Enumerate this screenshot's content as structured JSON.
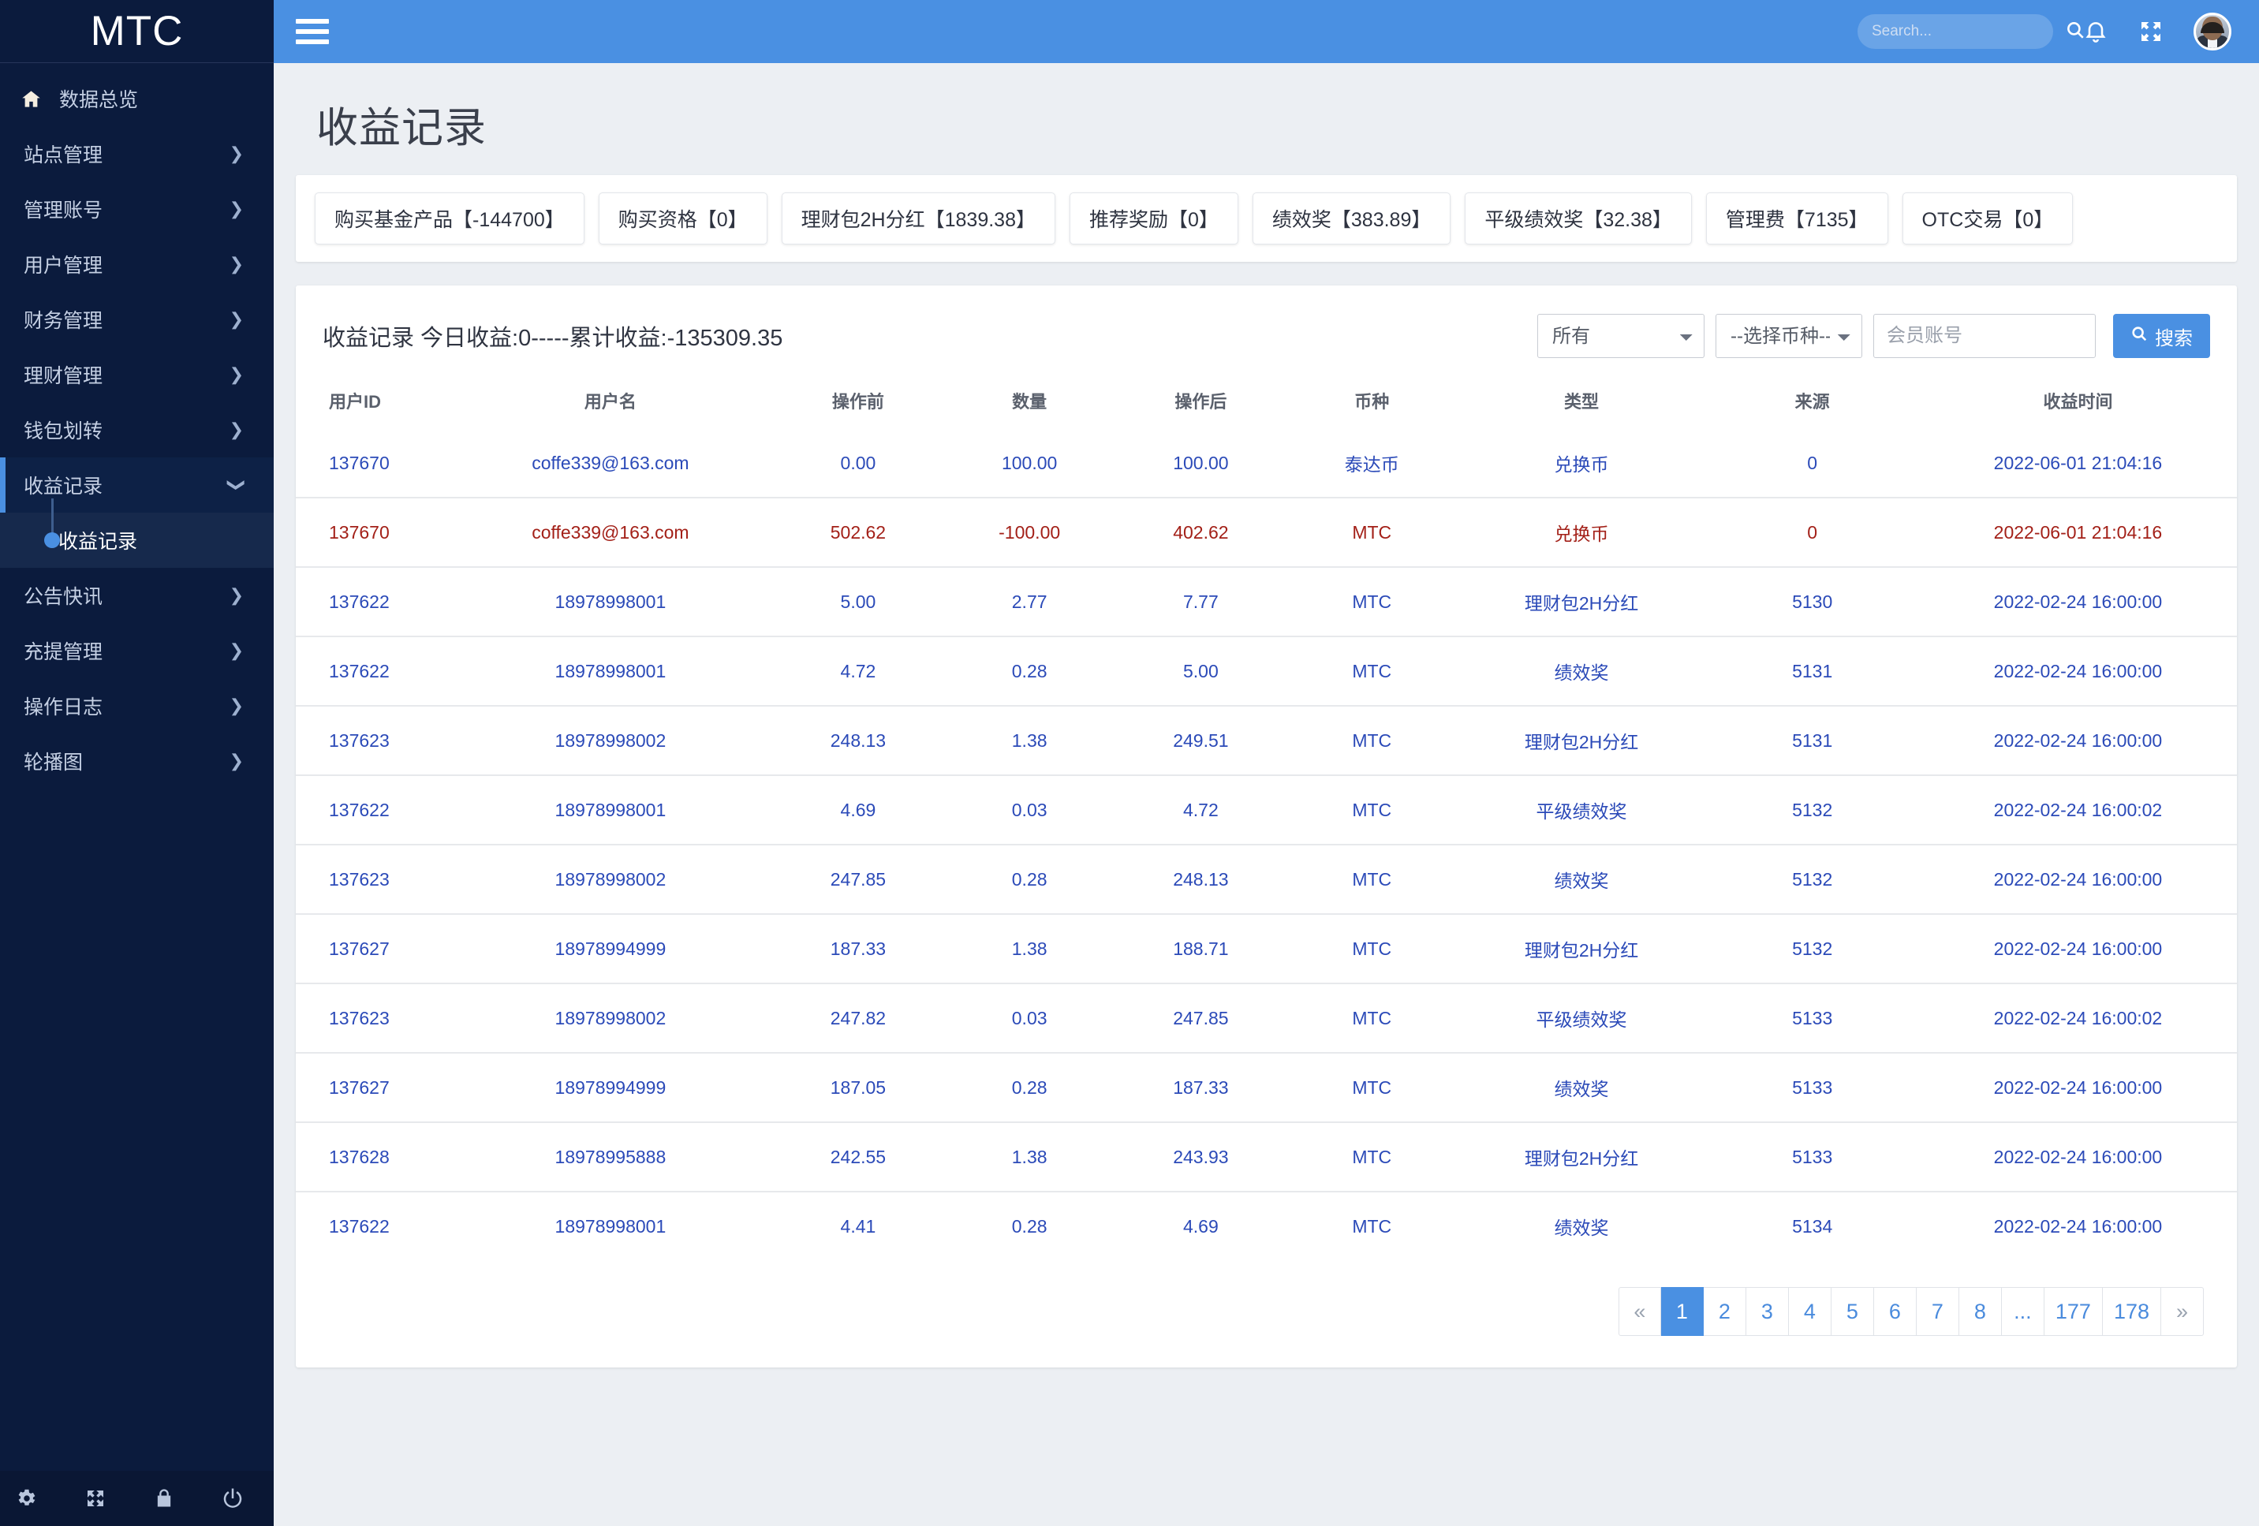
{
  "brand": {
    "title": "MTC"
  },
  "topbar": {
    "menu_icon": "hamburger-icon",
    "search_placeholder": "Search...",
    "search_value": "",
    "bell_icon": "bell-icon",
    "fullscreen_icon": "expand-icon",
    "avatar": "user-avatar"
  },
  "sidebar": {
    "home": {
      "label": "数据总览",
      "icon": "home-icon"
    },
    "items": [
      {
        "label": "站点管理",
        "expandable": true
      },
      {
        "label": "管理账号",
        "expandable": true
      },
      {
        "label": "用户管理",
        "expandable": true
      },
      {
        "label": "财务管理",
        "expandable": true
      },
      {
        "label": "理财管理",
        "expandable": true
      },
      {
        "label": "钱包划转",
        "expandable": true
      }
    ],
    "active_group": {
      "label": "收益记录",
      "expandable": true
    },
    "active_sub": {
      "label": "收益记录"
    },
    "items_after": [
      {
        "label": "公告快讯",
        "expandable": true
      },
      {
        "label": "充提管理",
        "expandable": true
      },
      {
        "label": "操作日志",
        "expandable": true
      },
      {
        "label": "轮播图",
        "expandable": true
      }
    ],
    "footer_icons": [
      "gear-icon",
      "expand-icon",
      "lock-icon",
      "power-icon"
    ]
  },
  "page": {
    "title": "收益记录"
  },
  "stats": [
    {
      "label": "购买基金产品【-144700】"
    },
    {
      "label": "购买资格【0】"
    },
    {
      "label": "理财包2H分红【1839.38】"
    },
    {
      "label": "推荐奖励【0】"
    },
    {
      "label": "绩效奖【383.89】"
    },
    {
      "label": "平级绩效奖【32.38】"
    },
    {
      "label": "管理费【7135】"
    },
    {
      "label": "OTC交易【0】"
    }
  ],
  "table": {
    "caption": "收益记录 今日收益:0-----累计收益:-135309.35",
    "filters": {
      "type_select": {
        "value": "所有",
        "options": [
          "所有"
        ]
      },
      "coin_select": {
        "value": "--选择币种--",
        "options": [
          "--选择币种--"
        ]
      },
      "account_input": {
        "value": "",
        "placeholder": "会员账号"
      },
      "search_button": "搜索"
    },
    "columns": [
      "用户ID",
      "用户名",
      "操作前",
      "数量",
      "操作后",
      "币种",
      "类型",
      "来源",
      "收益时间"
    ],
    "rows": [
      {
        "color": "blue",
        "cells": [
          "137670",
          "coffe339@163.com",
          "0.00",
          "100.00",
          "100.00",
          "泰达币",
          "兑换币",
          "0",
          "2022-06-01 21:04:16"
        ]
      },
      {
        "color": "red",
        "cells": [
          "137670",
          "coffe339@163.com",
          "502.62",
          "-100.00",
          "402.62",
          "MTC",
          "兑换币",
          "0",
          "2022-06-01 21:04:16"
        ]
      },
      {
        "color": "blue",
        "cells": [
          "137622",
          "18978998001",
          "5.00",
          "2.77",
          "7.77",
          "MTC",
          "理财包2H分红",
          "5130",
          "2022-02-24 16:00:00"
        ]
      },
      {
        "color": "blue",
        "cells": [
          "137622",
          "18978998001",
          "4.72",
          "0.28",
          "5.00",
          "MTC",
          "绩效奖",
          "5131",
          "2022-02-24 16:00:00"
        ]
      },
      {
        "color": "blue",
        "cells": [
          "137623",
          "18978998002",
          "248.13",
          "1.38",
          "249.51",
          "MTC",
          "理财包2H分红",
          "5131",
          "2022-02-24 16:00:00"
        ]
      },
      {
        "color": "blue",
        "cells": [
          "137622",
          "18978998001",
          "4.69",
          "0.03",
          "4.72",
          "MTC",
          "平级绩效奖",
          "5132",
          "2022-02-24 16:00:02"
        ]
      },
      {
        "color": "blue",
        "cells": [
          "137623",
          "18978998002",
          "247.85",
          "0.28",
          "248.13",
          "MTC",
          "绩效奖",
          "5132",
          "2022-02-24 16:00:00"
        ]
      },
      {
        "color": "blue",
        "cells": [
          "137627",
          "18978994999",
          "187.33",
          "1.38",
          "188.71",
          "MTC",
          "理财包2H分红",
          "5132",
          "2022-02-24 16:00:00"
        ]
      },
      {
        "color": "blue",
        "cells": [
          "137623",
          "18978998002",
          "247.82",
          "0.03",
          "247.85",
          "MTC",
          "平级绩效奖",
          "5133",
          "2022-02-24 16:00:02"
        ]
      },
      {
        "color": "blue",
        "cells": [
          "137627",
          "18978994999",
          "187.05",
          "0.28",
          "187.33",
          "MTC",
          "绩效奖",
          "5133",
          "2022-02-24 16:00:00"
        ]
      },
      {
        "color": "blue",
        "cells": [
          "137628",
          "18978995888",
          "242.55",
          "1.38",
          "243.93",
          "MTC",
          "理财包2H分红",
          "5133",
          "2022-02-24 16:00:00"
        ]
      },
      {
        "color": "blue",
        "cells": [
          "137622",
          "18978998001",
          "4.41",
          "0.28",
          "4.69",
          "MTC",
          "绩效奖",
          "5134",
          "2022-02-24 16:00:00"
        ]
      }
    ],
    "pagination": {
      "prev": "«",
      "next": "»",
      "pages": [
        "1",
        "2",
        "3",
        "4",
        "5",
        "6",
        "7",
        "8",
        "...",
        "177",
        "178"
      ],
      "active": "1"
    }
  },
  "colors": {
    "sidebar_bg": "#0b1b3d",
    "topbar_blue": "#4a90e2",
    "row_blue": "#2b4ab8",
    "row_red": "#a32018",
    "page_bg": "#eceff3"
  }
}
